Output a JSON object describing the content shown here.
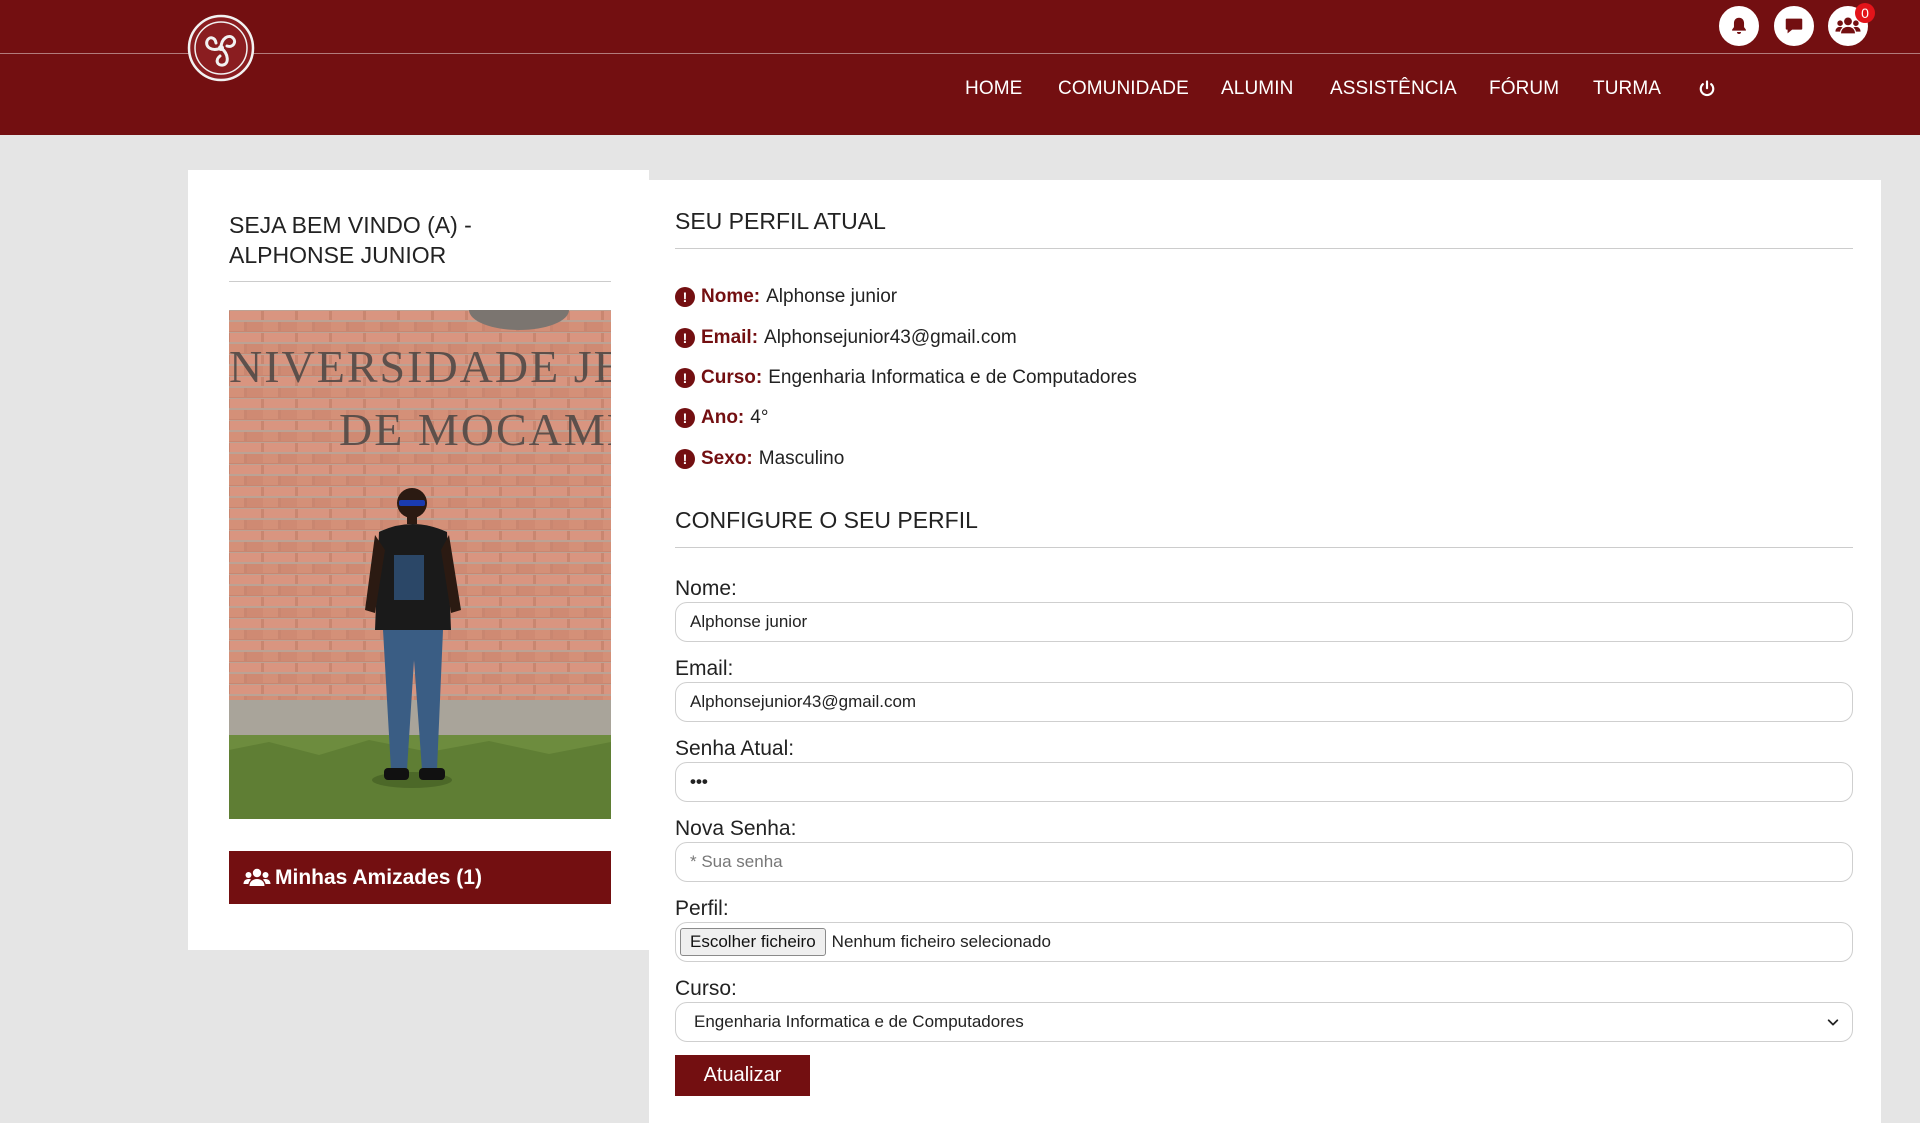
{
  "header": {
    "notification_count": "0",
    "nav": [
      {
        "label": "HOME"
      },
      {
        "label": "COMUNIDADE"
      },
      {
        "label": "ALUMIN"
      },
      {
        "label": "ASSISTÊNCIA"
      },
      {
        "label": "FÓRUM"
      },
      {
        "label": "TURMA"
      }
    ]
  },
  "sidebar": {
    "welcome": "SEJA BEM VINDO (A) - ALPHONSE JUNIOR",
    "photo_sign_line1": "NIVERSIDADE JEA",
    "photo_sign_line2": "DE MOCAMBIC",
    "friends_button": "Minhas Amizades (1)"
  },
  "profile": {
    "title": "SEU PERFIL ATUAL",
    "items": [
      {
        "label": "Nome:",
        "value": "Alphonse junior"
      },
      {
        "label": "Email:",
        "value": "Alphonsejunior43@gmail.com"
      },
      {
        "label": "Curso:",
        "value": "Engenharia Informatica e de Computadores"
      },
      {
        "label": "Ano:",
        "value": "4°"
      },
      {
        "label": "Sexo:",
        "value": "Masculino"
      }
    ]
  },
  "form": {
    "title": "CONFIGURE O SEU PERFIL",
    "name_label": "Nome:",
    "name_value": "Alphonse junior",
    "email_label": "Email:",
    "email_value": "Alphonsejunior43@gmail.com",
    "current_password_label": "Senha Atual:",
    "current_password_value": "•••",
    "new_password_label": "Nova Senha:",
    "new_password_placeholder": "* Sua senha",
    "profile_label": "Perfil:",
    "file_button": "Escolher ficheiro",
    "file_status": "Nenhum ficheiro selecionado",
    "course_label": "Curso:",
    "course_selected": "Engenharia Informatica e de Computadores",
    "submit": "Atualizar"
  },
  "colors": {
    "brand": "#730f11",
    "badge": "#e3141a",
    "page_bg": "#e5e5e5"
  },
  "icons": [
    "logo-icon",
    "bell-icon",
    "chat-icon",
    "users-icon",
    "power-icon",
    "exclamation-icon",
    "chevron-down-icon"
  ]
}
